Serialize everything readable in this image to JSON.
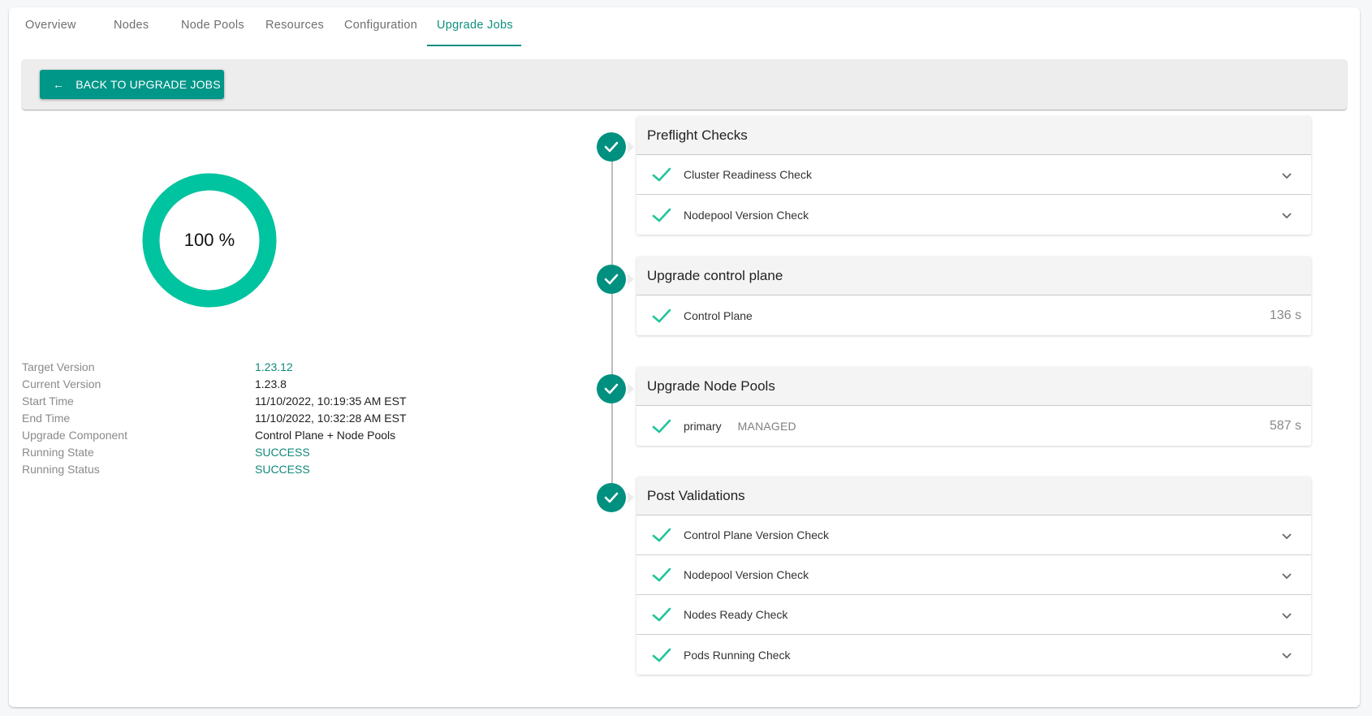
{
  "tabs": [
    {
      "label": "Overview",
      "active": false
    },
    {
      "label": "Nodes",
      "active": false
    },
    {
      "label": "Node Pools",
      "active": false
    },
    {
      "label": "Resources",
      "active": false
    },
    {
      "label": "Configuration",
      "active": false
    },
    {
      "label": "Upgrade Jobs",
      "active": true
    }
  ],
  "toolbar": {
    "back_label": "BACK TO UPGRADE JOBS",
    "back_icon": "arrow-left-icon"
  },
  "progress": {
    "percent": 100,
    "label": "100 %",
    "color": "#00c49f"
  },
  "info": [
    {
      "label": "Target Version",
      "value": "1.23.12",
      "highlight": true
    },
    {
      "label": "Current Version",
      "value": "1.23.8",
      "highlight": false
    },
    {
      "label": "Start Time",
      "value": "11/10/2022, 10:19:35 AM EST",
      "highlight": false
    },
    {
      "label": "End Time",
      "value": "11/10/2022, 10:32:28 AM EST",
      "highlight": false
    },
    {
      "label": "Upgrade Component",
      "value": "Control Plane + Node Pools",
      "highlight": false
    },
    {
      "label": "Running State",
      "value": "SUCCESS",
      "highlight": true
    },
    {
      "label": "Running Status",
      "value": "SUCCESS",
      "highlight": true
    }
  ],
  "steps": [
    {
      "title": "Preflight Checks",
      "status": "complete",
      "items": [
        {
          "label": "Cluster Readiness Check",
          "expandable": true
        },
        {
          "label": "Nodepool Version Check",
          "expandable": true
        }
      ]
    },
    {
      "title": "Upgrade control plane",
      "status": "complete",
      "items": [
        {
          "label": "Control Plane",
          "duration": "136 s"
        }
      ]
    },
    {
      "title": "Upgrade Node Pools",
      "status": "complete",
      "items": [
        {
          "label": "primary",
          "tag": "MANAGED",
          "duration": "587 s"
        }
      ]
    },
    {
      "title": "Post Validations",
      "status": "complete",
      "items": [
        {
          "label": "Control Plane Version Check",
          "expandable": true
        },
        {
          "label": "Nodepool Version Check",
          "expandable": true
        },
        {
          "label": "Nodes Ready Check",
          "expandable": true
        },
        {
          "label": "Pods Running Check",
          "expandable": true
        }
      ]
    }
  ],
  "colors": {
    "accent": "#009688",
    "active_tab": "#0e8f80",
    "step_dot": "#00907f",
    "check": "#1fc59a"
  }
}
